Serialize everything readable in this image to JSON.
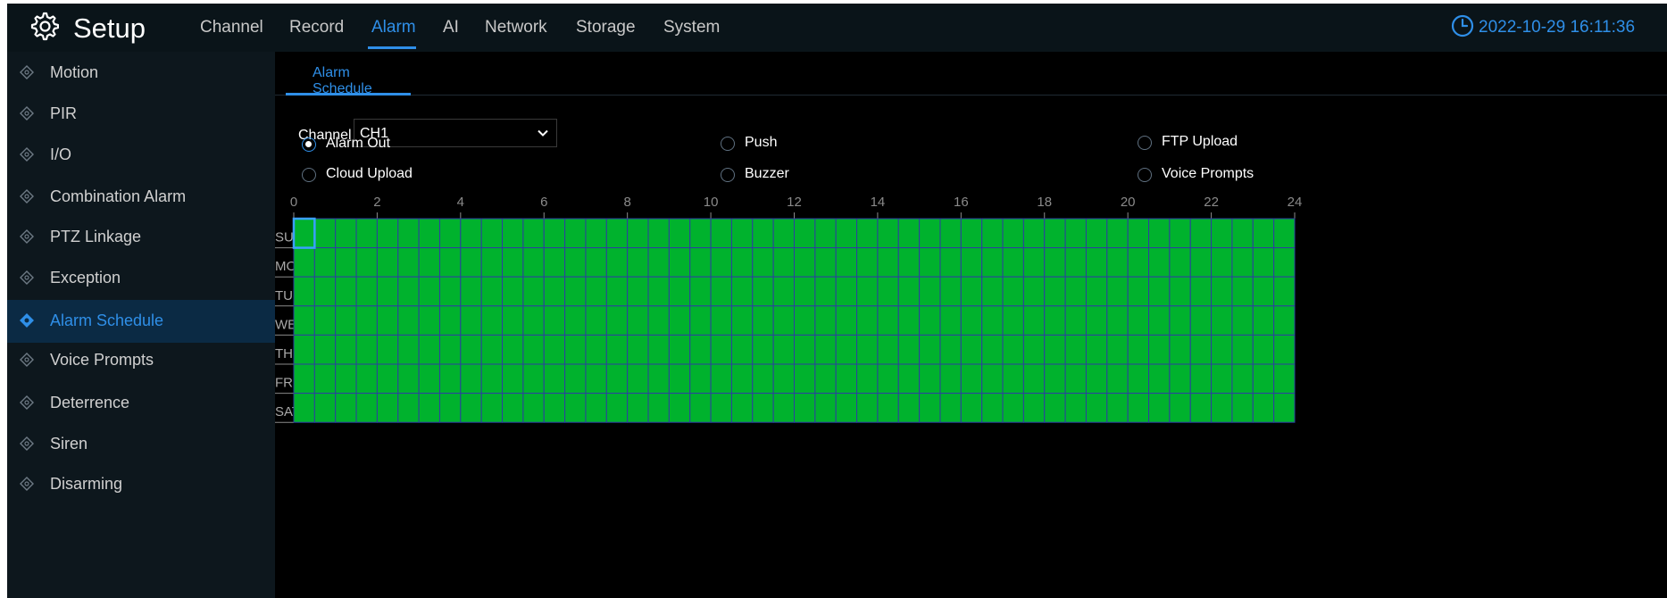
{
  "header": {
    "title": "Setup",
    "tabs": [
      {
        "label": "Channel",
        "active": false
      },
      {
        "label": "Record",
        "active": false
      },
      {
        "label": "Alarm",
        "active": true
      },
      {
        "label": "AI",
        "active": false
      },
      {
        "label": "Network",
        "active": false
      },
      {
        "label": "Storage",
        "active": false
      },
      {
        "label": "System",
        "active": false
      }
    ],
    "datetime": "2022-10-29 16:11:36"
  },
  "sidebar": {
    "items": [
      {
        "label": "Motion",
        "active": false
      },
      {
        "label": "PIR",
        "active": false
      },
      {
        "label": "I/O",
        "active": false
      },
      {
        "label": "Combination Alarm",
        "active": false
      },
      {
        "label": "PTZ Linkage",
        "active": false
      },
      {
        "label": "Exception",
        "active": false
      },
      {
        "label": "Alarm Schedule",
        "active": true
      },
      {
        "label": "Voice Prompts",
        "active": false
      },
      {
        "label": "Deterrence",
        "active": false
      },
      {
        "label": "Siren",
        "active": false
      },
      {
        "label": "Disarming",
        "active": false
      }
    ]
  },
  "main": {
    "subtab": "Alarm Schedule",
    "channel": {
      "label": "Channel",
      "value": "CH1"
    },
    "options": [
      {
        "label": "Alarm Out",
        "checked": true
      },
      {
        "label": "Push",
        "checked": false
      },
      {
        "label": "FTP Upload",
        "checked": false
      },
      {
        "label": "Cloud Upload",
        "checked": false
      },
      {
        "label": "Buzzer",
        "checked": false
      },
      {
        "label": "Voice Prompts",
        "checked": false
      }
    ],
    "schedule": {
      "hour_labels": [
        "0",
        "2",
        "4",
        "6",
        "8",
        "10",
        "12",
        "14",
        "16",
        "18",
        "20",
        "22",
        "24"
      ],
      "days": [
        "SUN",
        "MON",
        "TUE",
        "WED",
        "THU",
        "FRI",
        "SAT"
      ],
      "slots_per_day": 48,
      "all_slots_enabled": true,
      "selected_day": "SUN",
      "selected_slot": 0
    }
  },
  "colors": {
    "accent": "#2f8fe8",
    "schedule_fill": "#00b22d",
    "grid_line": "#2d3fa0",
    "header_bg": "#0a1419",
    "sidebar_bg": "#0d171d",
    "sidebar_active_bg": "#0b2a44"
  },
  "icons": {
    "logo": "gear-icon",
    "clock": "clock-icon",
    "sidebar_item": "diamond-icon",
    "dropdown": "chevron-down-icon"
  }
}
